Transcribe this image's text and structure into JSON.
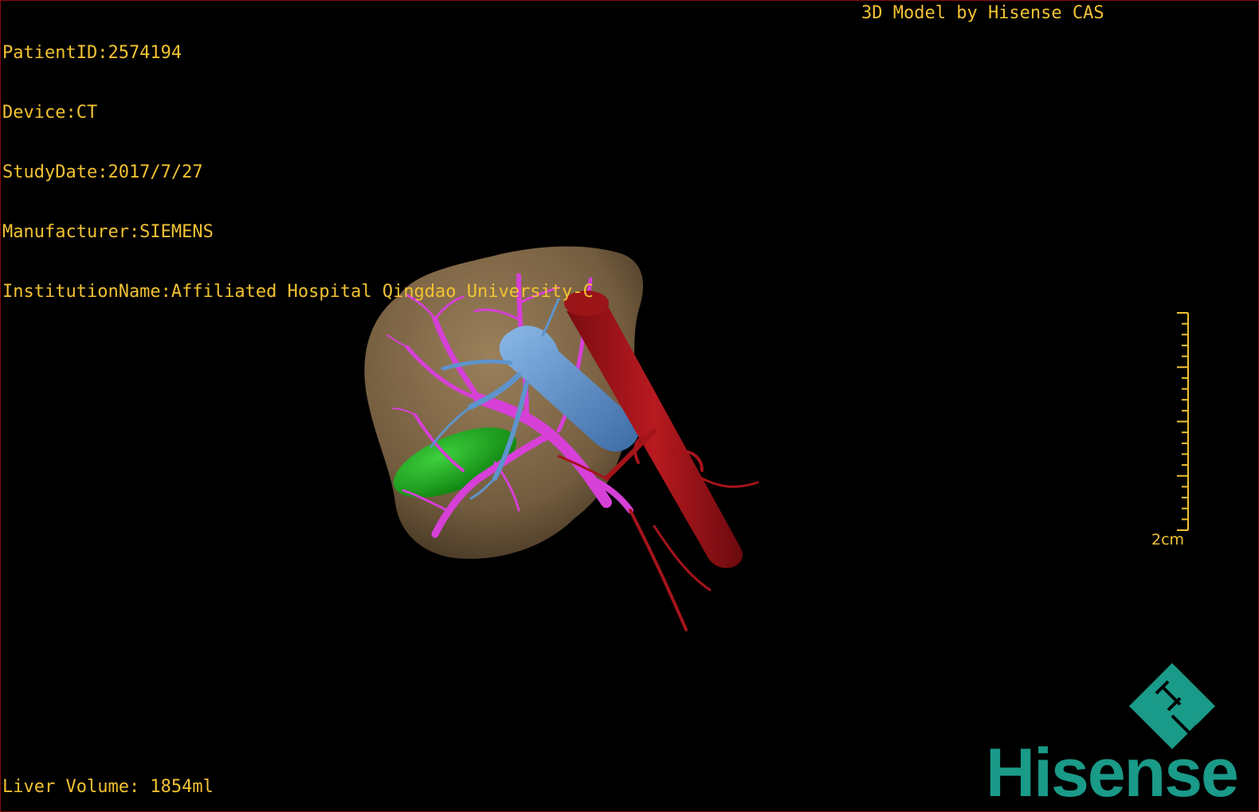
{
  "patient_info": {
    "patient_id": "PatientID:2574194",
    "device": "Device:CT",
    "study_date": "StudyDate:2017/7/27",
    "manufacturer": "Manufacturer:SIEMENS",
    "institution": "InstitutionName:Affiliated Hospital Qingdao University-C"
  },
  "brand_label": "3D Model by Hisense CAS",
  "liver_volume": "Liver Volume: 1854ml",
  "scale": {
    "label": "2cm"
  },
  "logo": {
    "text": "Hisense",
    "color": "#1a9a88"
  },
  "colors": {
    "text": "#f2c232",
    "liver": "#8c7350",
    "portal_vein": "#d640d6",
    "hepatic_vein": "#5e94cc",
    "artery": "#a4141a",
    "gallbladder": "#14a014",
    "background": "#000000"
  }
}
